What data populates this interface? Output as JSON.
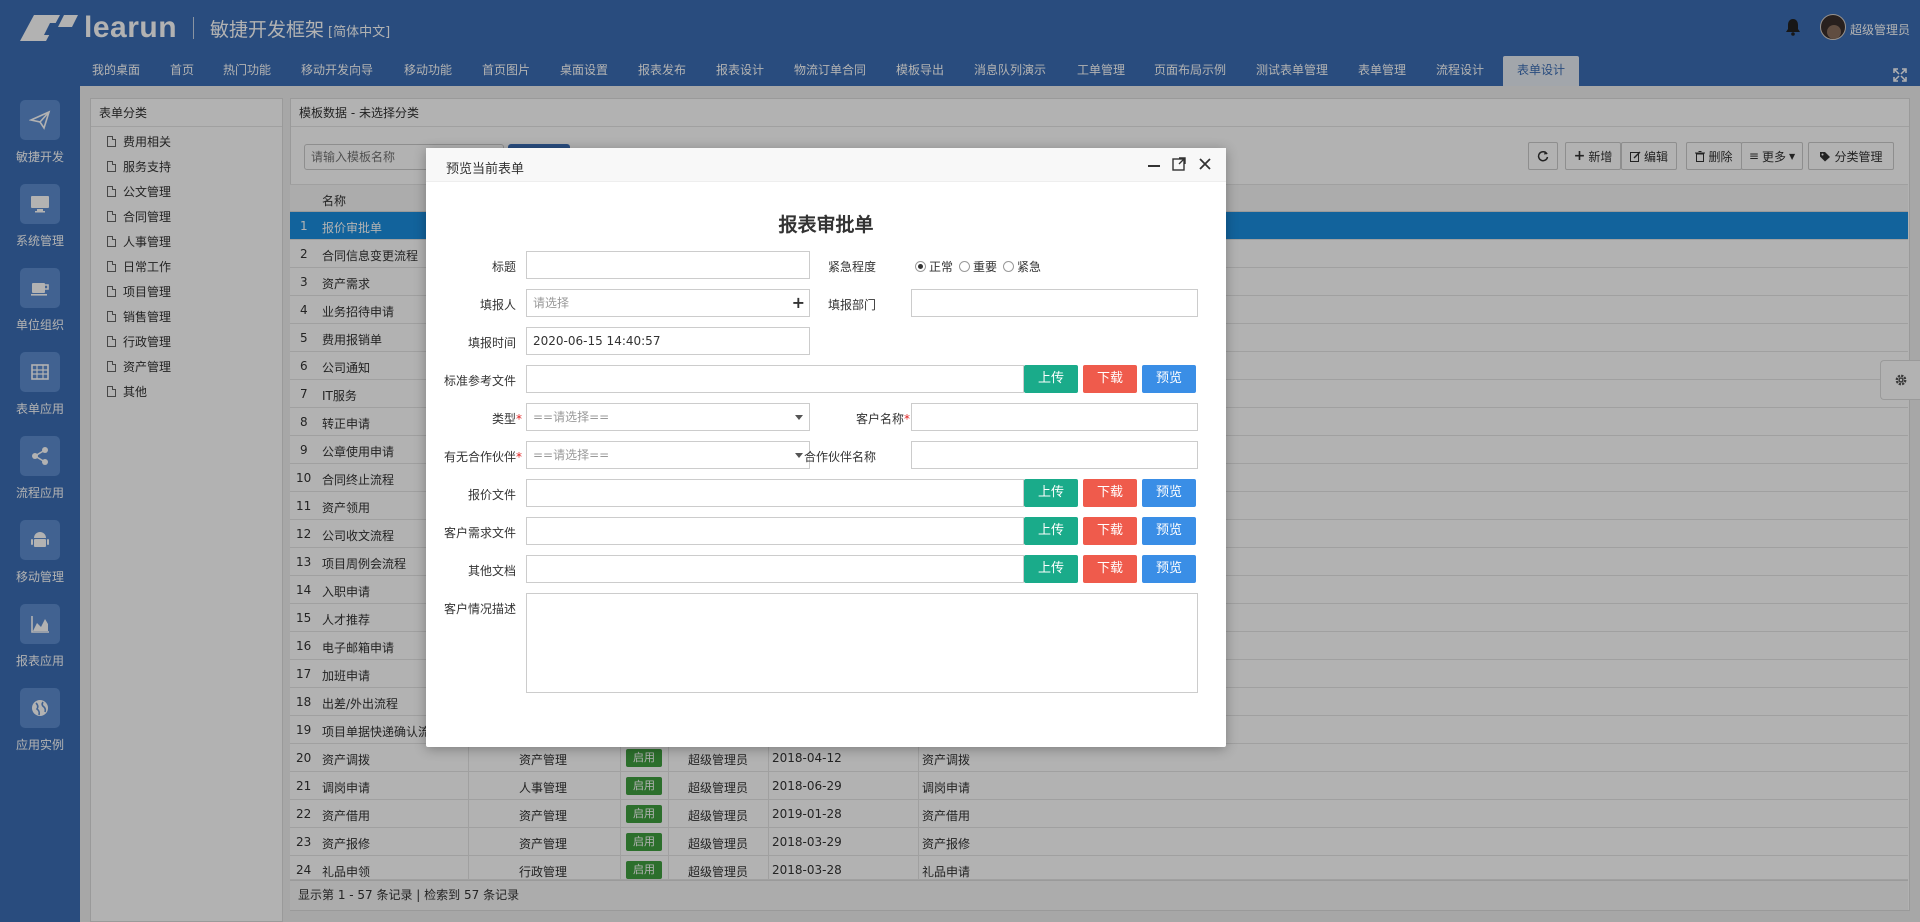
{
  "header": {
    "brand": "learun",
    "subtitle": "敏捷开发框架",
    "language": "[简体中文]",
    "user_name": "超级管理员"
  },
  "nav": {
    "items": [
      "我的桌面",
      "首页",
      "热门功能",
      "移动开发向导",
      "移动功能",
      "首页图片",
      "桌面设置",
      "报表发布",
      "报表设计",
      "物流订单合同",
      "模板导出",
      "消息队列演示",
      "工单管理",
      "页面布局示例",
      "测试表单管理",
      "表单管理",
      "流程设计",
      "表单设计"
    ],
    "active": "表单设计"
  },
  "sidebar": {
    "items": [
      {
        "label": "敏捷开发",
        "icon": "paper-plane-icon"
      },
      {
        "label": "系统管理",
        "icon": "monitor-icon"
      },
      {
        "label": "单位组织",
        "icon": "coffee-icon"
      },
      {
        "label": "表单应用",
        "icon": "grid-icon"
      },
      {
        "label": "流程应用",
        "icon": "share-icon"
      },
      {
        "label": "移动管理",
        "icon": "android-icon"
      },
      {
        "label": "报表应用",
        "icon": "area-chart-icon"
      },
      {
        "label": "应用实例",
        "icon": "globe-icon"
      }
    ]
  },
  "categories": {
    "title": "表单分类",
    "items": [
      "费用相关",
      "服务支持",
      "公文管理",
      "合同管理",
      "人事管理",
      "日常工作",
      "项目管理",
      "销售管理",
      "行政管理",
      "资产管理",
      "其他"
    ]
  },
  "templates": {
    "title": "模板数据 - 未选择分类",
    "search_placeholder": "请输入模板名称",
    "toolbar": {
      "add": "新增",
      "edit": "编辑",
      "delete": "删除",
      "more": "更多",
      "category": "分类管理"
    },
    "column_name": "名称",
    "rows": [
      {
        "no": "1",
        "name": "报价审批单"
      },
      {
        "no": "2",
        "name": "合同信息变更流程"
      },
      {
        "no": "3",
        "name": "资产需求"
      },
      {
        "no": "4",
        "name": "业务招待申请"
      },
      {
        "no": "5",
        "name": "费用报销单"
      },
      {
        "no": "6",
        "name": "公司通知"
      },
      {
        "no": "7",
        "name": "IT服务"
      },
      {
        "no": "8",
        "name": "转正申请"
      },
      {
        "no": "9",
        "name": "公章使用申请"
      },
      {
        "no": "10",
        "name": "合同终止流程"
      },
      {
        "no": "11",
        "name": "资产领用"
      },
      {
        "no": "12",
        "name": "公司收文流程"
      },
      {
        "no": "13",
        "name": "项目周例会流程"
      },
      {
        "no": "14",
        "name": "入职申请"
      },
      {
        "no": "15",
        "name": "人才推荐"
      },
      {
        "no": "16",
        "name": "电子邮箱申请"
      },
      {
        "no": "17",
        "name": "加班申请"
      },
      {
        "no": "18",
        "name": "出差/外出流程"
      },
      {
        "no": "19",
        "name": "项目单据快递确认流"
      },
      {
        "no": "20",
        "name": "资产调拨",
        "category": "资产管理",
        "status": "启用",
        "creator": "超级管理员",
        "date": "2018-04-12",
        "desc": "资产调拨"
      },
      {
        "no": "21",
        "name": "调岗申请",
        "category": "人事管理",
        "status": "启用",
        "creator": "超级管理员",
        "date": "2018-06-29",
        "desc": "调岗申请"
      },
      {
        "no": "22",
        "name": "资产借用",
        "category": "资产管理",
        "status": "启用",
        "creator": "超级管理员",
        "date": "2019-01-28",
        "desc": "资产借用"
      },
      {
        "no": "23",
        "name": "资产报修",
        "category": "资产管理",
        "status": "启用",
        "creator": "超级管理员",
        "date": "2018-03-29",
        "desc": "资产报修"
      },
      {
        "no": "24",
        "name": "礼品申领",
        "category": "行政管理",
        "status": "启用",
        "creator": "超级管理员",
        "date": "2018-03-28",
        "desc": "礼品申请"
      }
    ],
    "footer": "显示第 1 - 57 条记录 | 检索到 57 条记录"
  },
  "dialog": {
    "title": "预览当前表单",
    "form_title": "报表审批单",
    "labels": {
      "title": "标题",
      "urgency": "紧急程度",
      "reporter": "填报人",
      "dept": "填报部门",
      "time": "填报时间",
      "std_file": "标准参考文件",
      "type": "类型",
      "customer": "客户名称",
      "has_partner": "有无合作伙伴",
      "partner_name": "合作伙伴名称",
      "quote_file": "报价文件",
      "req_file": "客户需求文件",
      "other_file": "其他文档",
      "customer_desc": "客户情况描述"
    },
    "urgency_options": [
      "正常",
      "重要",
      "紧急"
    ],
    "urgency_selected": "正常",
    "reporter_placeholder": "请选择",
    "time_value": "2020-06-15 14:40:57",
    "select_placeholder": "==请选择==",
    "btn_upload": "上传",
    "btn_download": "下载",
    "btn_preview": "预览"
  },
  "colors": {
    "primary": "#3b6eb5",
    "selected_row": "#1a8fe0",
    "upload": "#1aab8a",
    "download": "#ef5b4c",
    "preview": "#3a8ee6",
    "status_badge": "#3f9f3f"
  }
}
